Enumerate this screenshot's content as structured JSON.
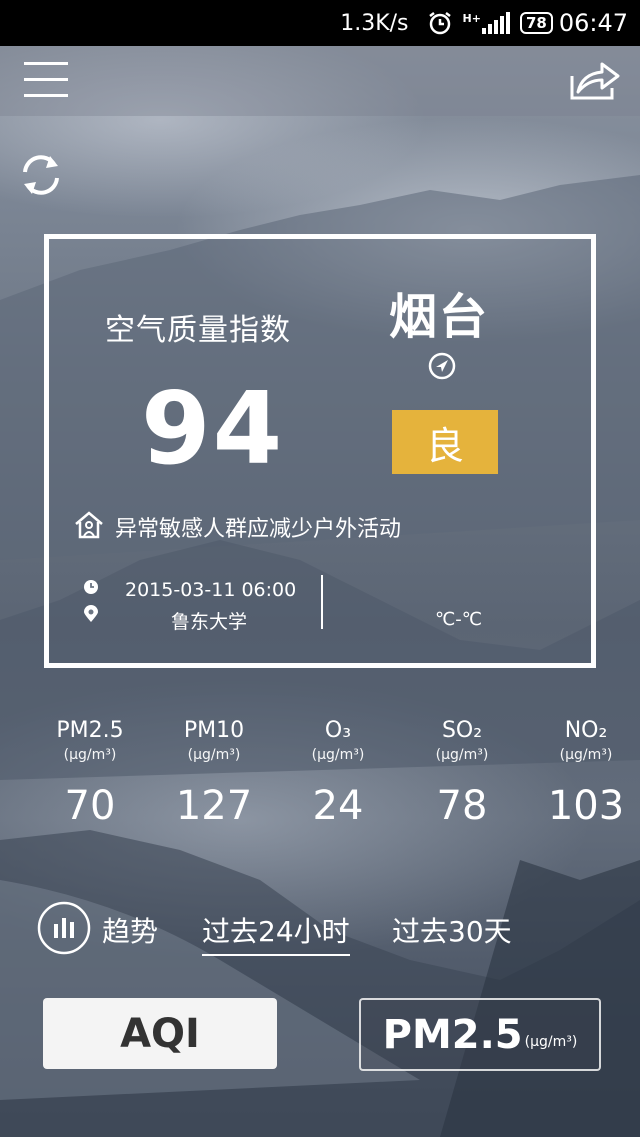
{
  "status_bar": {
    "speed": "1.3K/s",
    "network": "H+",
    "battery": "78",
    "time": "06:47"
  },
  "toolbar": {
    "menu_icon": "hamburger-menu-icon",
    "share_icon": "share-arrow-icon"
  },
  "refresh_icon": "refresh-icon",
  "card": {
    "title": "空气质量指数",
    "city": "烟台",
    "aqi": "94",
    "grade": "良",
    "grade_color": "#e5b33c",
    "advice": "异常敏感人群应减少户外活动",
    "datetime": "2015-03-11 06:00",
    "station": "鲁东大学",
    "temperature": "℃-℃"
  },
  "pollutants": [
    {
      "name": "PM2.5",
      "unit": "(μg/m³)",
      "value": "70"
    },
    {
      "name": "PM10",
      "unit": "(μg/m³)",
      "value": "127"
    },
    {
      "name": "O₃",
      "unit": "(μg/m³)",
      "value": "24"
    },
    {
      "name": "SO₂",
      "unit": "(μg/m³)",
      "value": "78"
    },
    {
      "name": "NO₂",
      "unit": "(μg/m³)",
      "value": "103"
    }
  ],
  "trend": {
    "label": "趋势",
    "tab_24h": "过去24小时",
    "tab_30d": "过去30天"
  },
  "buttons": {
    "aqi": "AQI",
    "pm": "PM2.5",
    "pm_unit": "(μg/m³)"
  }
}
